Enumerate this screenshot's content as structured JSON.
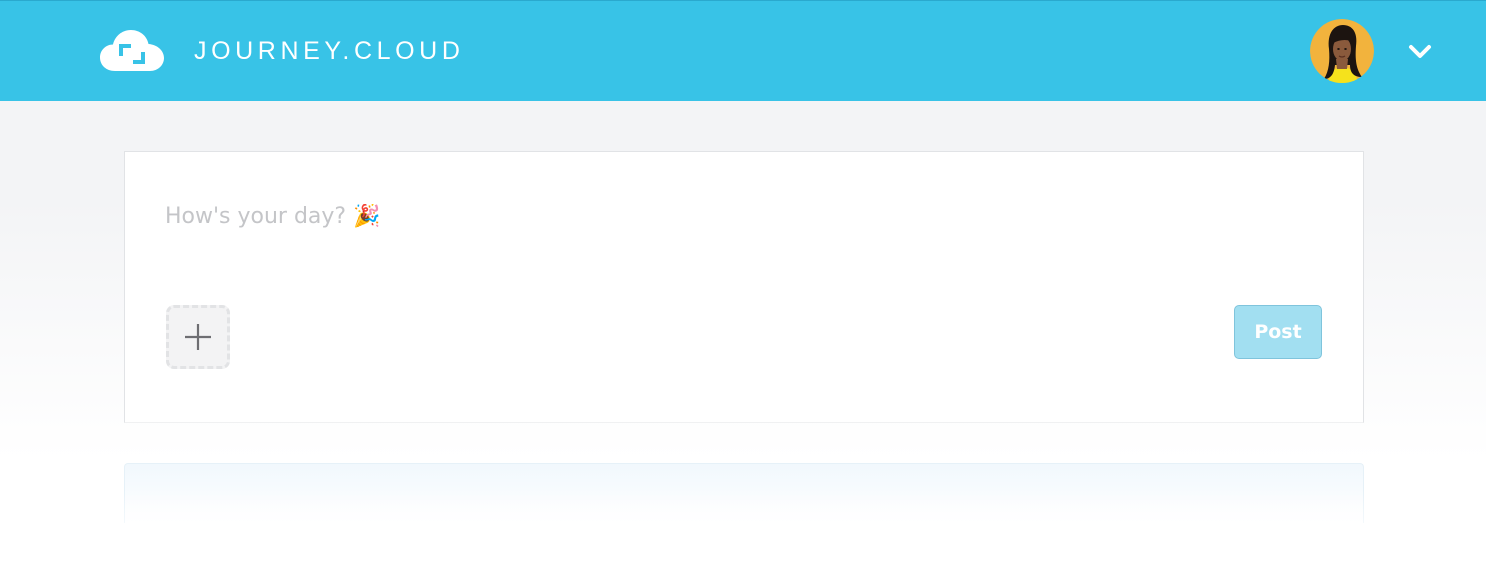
{
  "header": {
    "brand": "JOURNEY.CLOUD",
    "icons": {
      "logo": "cloud-logo-icon",
      "menu": "chevron-down-icon"
    },
    "colors": {
      "bar": "#38c3e7",
      "text": "#ffffff"
    }
  },
  "composer": {
    "placeholder": "How's your day? 🎉",
    "value": "",
    "post_label": "Post",
    "add_icon": "plus-icon",
    "colors": {
      "post_button": "#a2dff1"
    }
  }
}
